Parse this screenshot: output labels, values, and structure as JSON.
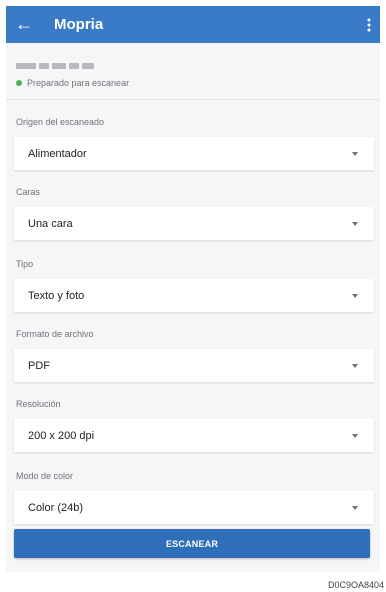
{
  "appbar": {
    "title": "Mopria",
    "back_icon": "arrow-back-icon",
    "menu_icon": "more-vert-icon",
    "color": "#3a7bc8"
  },
  "printer": {
    "status": "Preparado para escanear",
    "status_color": "#4caf50"
  },
  "fields": [
    {
      "label": "Origen del escaneado",
      "value": "Alimentador"
    },
    {
      "label": "Caras",
      "value": "Una cara"
    },
    {
      "label": "Tipo",
      "value": "Texto y foto"
    },
    {
      "label": "Formato de archivo",
      "value": "PDF"
    },
    {
      "label": "Resolución",
      "value": "200 x 200 dpi"
    },
    {
      "label": "Modo de color",
      "value": "Color (24b)"
    }
  ],
  "scan_button": {
    "label": "ESCANEAR",
    "color": "#2f6fb9"
  },
  "figure_code": "D0C9OA8404"
}
